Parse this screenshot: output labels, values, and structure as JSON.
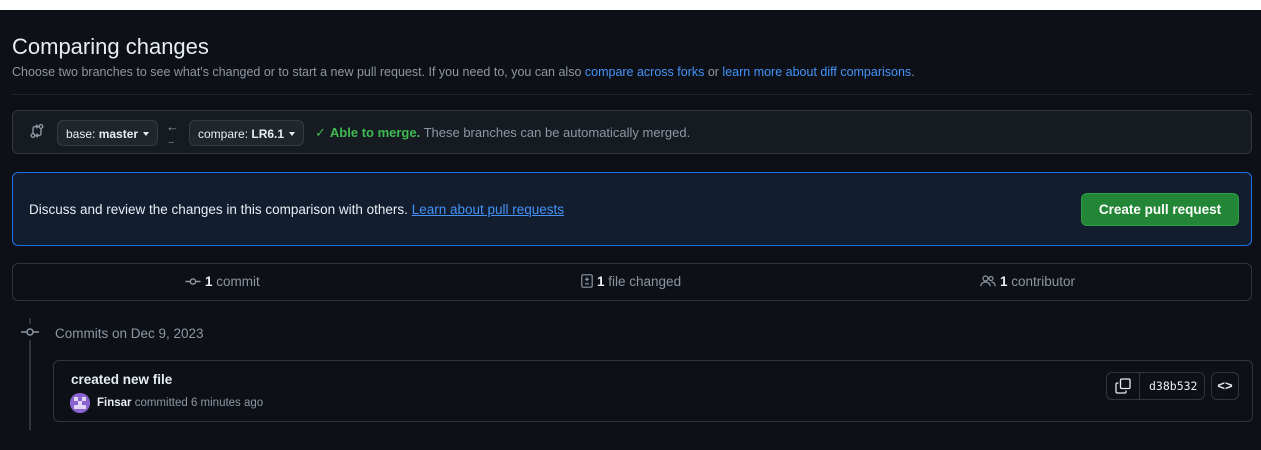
{
  "page": {
    "title": "Comparing changes",
    "subtitle_prefix": "Choose two branches to see what's changed or to start a new pull request. If you need to, you can also ",
    "compare_forks_link": "compare across forks",
    "subtitle_mid": " or ",
    "learn_diff_link": "learn more about diff comparisons",
    "subtitle_suffix": "."
  },
  "range": {
    "base_label": "base: ",
    "base_value": "master",
    "compare_label": "compare: ",
    "compare_value": "LR6.1",
    "arrow": "←",
    "arrow_dots": "...",
    "merge_check": "✓",
    "merge_status": "Able to merge.",
    "merge_detail": " These branches can be automatically merged."
  },
  "discuss": {
    "text": "Discuss and review the changes in this comparison with others. ",
    "link": "Learn about pull requests",
    "button": "Create pull request"
  },
  "stats": {
    "commits_count": "1",
    "commits_label": " commit",
    "files_count": "1",
    "files_label": " file changed",
    "contributors_count": "1",
    "contributors_label": " contributor"
  },
  "commits": {
    "date_heading": "Commits on Dec 9, 2023",
    "items": [
      {
        "title": "created new file",
        "author": "Finsar",
        "meta": " committed 6 minutes ago",
        "sha": "d38b532",
        "browse": "<>"
      }
    ]
  },
  "colors": {
    "background": "#0d1117",
    "accent_link": "#4493f8",
    "success": "#3fb950",
    "button_green": "#238636"
  }
}
